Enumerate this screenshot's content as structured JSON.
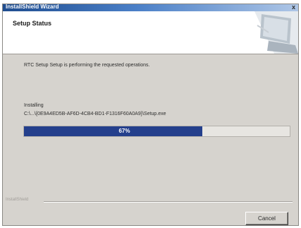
{
  "window": {
    "title": "InstallShield Wizard",
    "close_glyph": "x"
  },
  "header": {
    "title": "Setup Status"
  },
  "status": {
    "message": "RTC Setup Setup is performing the requested operations."
  },
  "progress": {
    "action_label": "Installing",
    "file_path": "C:\\...\\{0E9A4ED5B-AF6D-4CB4-BD1-F1316F60A0A9}\\Setup.exe",
    "percent_text": "67%",
    "value_percent": 67
  },
  "footer": {
    "brand": "InstallShield"
  },
  "buttons": {
    "cancel_label": "Cancel"
  },
  "colors": {
    "progress_fill": "#243f8c",
    "titlebar": "#1f4d8f"
  }
}
